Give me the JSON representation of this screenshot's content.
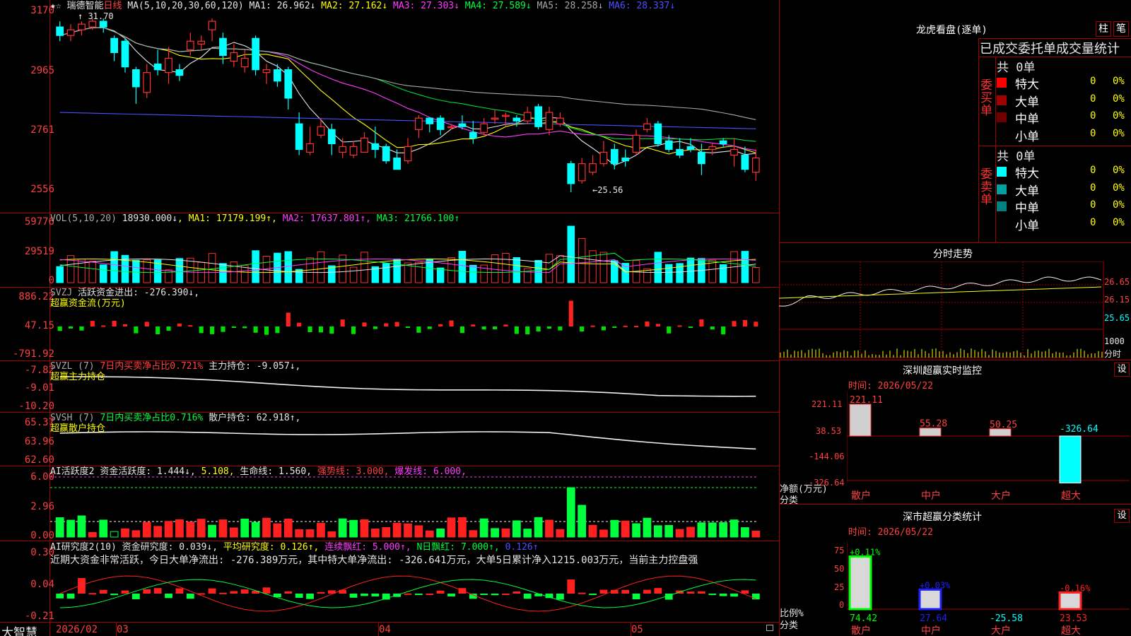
{
  "stock": {
    "name": "瑞德智能",
    "period": "日线",
    "ma_label": "MA(5,10,20,30,60,120)",
    "ma_values": [
      {
        "k": "MA1",
        "v": "26.962↓",
        "c": "#e6e6e6"
      },
      {
        "k": "MA2",
        "v": "27.162↓",
        "c": "#ffff00"
      },
      {
        "k": "MA3",
        "v": "27.303↓",
        "c": "#ff3cff"
      },
      {
        "k": "MA4",
        "v": "27.589↓",
        "c": "#00ff3c"
      },
      {
        "k": "MA5",
        "v": "28.258↓",
        "c": "#a8a8a8"
      },
      {
        "k": "MA6",
        "v": "28.337↓",
        "c": "#4f4fff"
      }
    ],
    "high_mark": "31.70",
    "low_mark": "25.56"
  },
  "axes": {
    "price": [
      "3170",
      "2965",
      "2761",
      "2556"
    ],
    "vol": [
      "59776",
      "29519",
      "0"
    ],
    "svzj": [
      "886.22",
      "47.15",
      "-791.92"
    ],
    "svzl": [
      "-7.82",
      "-9.01",
      "-10.20"
    ],
    "svsh": [
      "65.37",
      "63.96",
      "62.60"
    ],
    "ai1": [
      "6.00",
      "2.96",
      "0.00"
    ],
    "ai2": [
      "0.30",
      "0.04",
      "-0.21"
    ]
  },
  "panels": {
    "vol": {
      "title": "VOL(5,10,20)",
      "value": "18930.000↓",
      "ma1": "MA1: 17179.199↑",
      "ma2": "MA2: 17637.801↑",
      "ma3": "MA3: 21766.100↑"
    },
    "svzj": {
      "title": "SVZJ",
      "label": "活跃资金进出: -276.390↓,",
      "sub": "超赢资金流(万元)"
    },
    "svzl": {
      "title": "SVZL (7)",
      "ratio": "7日内买卖净占比0.721%",
      "hold": "主力持仓: -9.057↓,",
      "sub": "超赢主力持仓"
    },
    "svsh": {
      "title": "SVSH (7)",
      "ratio": "7日内买卖净占比0.716%",
      "hold": "散户持仓: 62.918↑,",
      "sub": "超赢散户持仓"
    },
    "ai1": {
      "title": "AI活跃度2",
      "a": "资金活跃度: 1.444↓,",
      "b": "5.108,",
      "c": "生命线: 1.560,",
      "d": "强势线: 3.000,",
      "e": "爆发线: 6.000,"
    },
    "ai2": {
      "title": "AI研究度2(10)",
      "a": "资金研究度: 0.039↓,",
      "b": "平均研究度: 0.126↑,",
      "c": "连续飘红: 5.000↑,",
      "d": "N日飘红: 7.000↑,",
      "e": "0.126↑",
      "summary": "近期大资金非常活跃，今日大单净流出: -276.389万元，其中特大单净流出: -326.641万元，大单5日累计净入1215.003万元，当前主力控盘强"
    }
  },
  "bottom": {
    "brand": "大智慧",
    "date1": "2026/02",
    "m1": "03",
    "m2": "04",
    "m3": "05"
  },
  "longhu": {
    "title": "龙虎看盘(逐单)",
    "tab1": "柱",
    "tab2": "笔",
    "header": "已成交委托单成交量统计",
    "buy_label": "委买单",
    "sell_label": "委卖单",
    "buy_total": "共 0单",
    "sell_total": "共 0单",
    "buy_rows": [
      {
        "l": "特大",
        "v": "0",
        "p": "0%",
        "c": "#ff0000"
      },
      {
        "l": "大单",
        "v": "0",
        "p": "0%",
        "c": "#a00000"
      },
      {
        "l": "中单",
        "v": "0",
        "p": "0%",
        "c": "#700000"
      },
      {
        "l": "小单",
        "v": "0",
        "p": "0%",
        "c": "#000"
      }
    ],
    "sell_rows": [
      {
        "l": "特大",
        "v": "0",
        "p": "0%",
        "c": "#00ffff"
      },
      {
        "l": "大单",
        "v": "0",
        "p": "0%",
        "c": "#00a0a0"
      },
      {
        "l": "中单",
        "v": "0",
        "p": "0%",
        "c": "#008080"
      },
      {
        "l": "小单",
        "v": "0",
        "p": "0%",
        "c": "#000"
      }
    ]
  },
  "intraday": {
    "title": "分时走势",
    "p1": "26.65",
    "p2": "26.15",
    "p3": "25.65",
    "vol": "1000",
    "vol2": "分时"
  },
  "sz_monitor": {
    "title": "深圳超赢实时监控",
    "gear": "设",
    "time": "时间: 2026/05/22",
    "axis": [
      "221.11",
      "38.53",
      "-144.06",
      "-326.64"
    ],
    "ylabel": "净额(万元)",
    "xlabel": "分类",
    "bars": [
      {
        "cat": "散户",
        "v": 221.11,
        "t": "221.11"
      },
      {
        "cat": "中户",
        "v": 55.28,
        "t": "55.28"
      },
      {
        "cat": "大户",
        "v": 50.25,
        "t": "50.25"
      },
      {
        "cat": "超大",
        "v": -326.64,
        "t": "-326.64"
      }
    ]
  },
  "sz_class": {
    "title": "深市超赢分类统计",
    "gear": "设",
    "time": "时间: 2026/05/22",
    "axis": [
      "75",
      "50",
      "25",
      "0"
    ],
    "ylabel": "比例%",
    "xlabel": "分类",
    "bars": [
      {
        "cat": "散户",
        "v": 74.42,
        "top": "+0.11%",
        "t": "74.42",
        "c": "#00ff00"
      },
      {
        "cat": "中户",
        "v": 27.64,
        "top": "+0.03%",
        "t": "27.64",
        "c": "#2020ff"
      },
      {
        "cat": "大户",
        "v": -25.58,
        "top": "",
        "t": "-25.58",
        "c": "#00ffff"
      },
      {
        "cat": "超大",
        "v": 23.53,
        "top": "-0.16%",
        "t": "23.53",
        "c": "#ff2020"
      }
    ]
  },
  "chart_data": {
    "type": "candlestick",
    "title": "瑞德智能 日线",
    "candles": [
      [
        31.4,
        31.1,
        31.6,
        30.9
      ],
      [
        31.1,
        31.3,
        31.5,
        30.9
      ],
      [
        31.3,
        31.5,
        31.6,
        31.1
      ],
      [
        31.4,
        31.6,
        31.7,
        31.3
      ],
      [
        31.6,
        31.4,
        31.7,
        31.2
      ],
      [
        31.0,
        30.5,
        31.1,
        30.2
      ],
      [
        30.9,
        30.0,
        31.0,
        29.8
      ],
      [
        29.9,
        29.3,
        30.0,
        28.7
      ],
      [
        29.1,
        29.8,
        30.1,
        28.9
      ],
      [
        30.1,
        29.9,
        30.6,
        29.7
      ],
      [
        29.8,
        30.3,
        30.7,
        29.4
      ],
      [
        29.9,
        29.7,
        30.1,
        29.5
      ],
      [
        30.6,
        30.9,
        31.2,
        30.4
      ],
      [
        30.8,
        30.9,
        31.1,
        30.6
      ],
      [
        31.3,
        31.6,
        31.7,
        30.9
      ],
      [
        31.0,
        30.4,
        31.2,
        30.1
      ],
      [
        30.2,
        30.5,
        30.8,
        30.0
      ],
      [
        30.0,
        30.3,
        30.6,
        29.8
      ],
      [
        31.0,
        29.9,
        31.1,
        29.7
      ],
      [
        29.8,
        29.9,
        30.1,
        29.4
      ],
      [
        29.9,
        29.5,
        30.1,
        29.3
      ],
      [
        29.9,
        28.9,
        30.0,
        28.5
      ],
      [
        28.0,
        27.1,
        28.4,
        26.9
      ],
      [
        27.0,
        27.3,
        27.9,
        26.9
      ],
      [
        27.6,
        27.9,
        28.2,
        27.5
      ],
      [
        27.8,
        27.3,
        28.0,
        26.9
      ],
      [
        27.0,
        27.2,
        27.5,
        26.8
      ],
      [
        26.9,
        27.2,
        27.4,
        26.8
      ],
      [
        27.0,
        27.5,
        27.7,
        27.0
      ],
      [
        27.3,
        27.1,
        27.9,
        26.8
      ],
      [
        27.2,
        26.7,
        27.3,
        26.6
      ],
      [
        26.8,
        26.4,
        27.1,
        26.4
      ],
      [
        26.7,
        27.2,
        27.5,
        26.6
      ],
      [
        27.8,
        28.2,
        28.3,
        27.5
      ],
      [
        28.2,
        28.0,
        28.2,
        27.7
      ],
      [
        28.2,
        27.8,
        28.3,
        27.6
      ],
      [
        27.9,
        27.9,
        28.0,
        27.8
      ],
      [
        28.0,
        27.9,
        28.3,
        27.8
      ],
      [
        27.7,
        27.5,
        28.1,
        27.3
      ],
      [
        27.7,
        28.0,
        28.2,
        27.6
      ],
      [
        28.2,
        28.2,
        28.5,
        28.0
      ],
      [
        28.3,
        28.3,
        28.4,
        27.9
      ],
      [
        28.2,
        28.1,
        28.3,
        27.9
      ],
      [
        28.1,
        28.4,
        28.6,
        28.0
      ],
      [
        28.6,
        27.9,
        28.7,
        27.8
      ],
      [
        27.8,
        28.4,
        28.6,
        27.6
      ],
      [
        28.0,
        28.2,
        28.4,
        27.9
      ],
      [
        26.6,
        25.9,
        26.7,
        25.6
      ],
      [
        26.0,
        26.6,
        26.8,
        25.9
      ],
      [
        26.3,
        26.6,
        26.9,
        26.2
      ],
      [
        26.6,
        27.0,
        27.4,
        26.5
      ],
      [
        27.1,
        26.6,
        27.3,
        26.4
      ],
      [
        26.8,
        26.7,
        27.1,
        26.5
      ],
      [
        27.0,
        27.6,
        27.8,
        26.9
      ],
      [
        27.8,
        28.0,
        28.2,
        27.7
      ],
      [
        28.0,
        27.3,
        28.1,
        27.2
      ],
      [
        27.4,
        27.1,
        27.6,
        27.0
      ],
      [
        27.1,
        26.9,
        27.5,
        26.8
      ],
      [
        27.2,
        27.1,
        27.5,
        27.0
      ],
      [
        27.0,
        26.6,
        27.3,
        26.2
      ],
      [
        27.1,
        27.2,
        27.3,
        26.9
      ],
      [
        27.4,
        27.3,
        27.5,
        27.2
      ],
      [
        26.9,
        27.1,
        27.5,
        26.5
      ],
      [
        26.9,
        26.4,
        27.2,
        26.3
      ],
      [
        26.3,
        26.8,
        27.1,
        26.0
      ]
    ]
  }
}
